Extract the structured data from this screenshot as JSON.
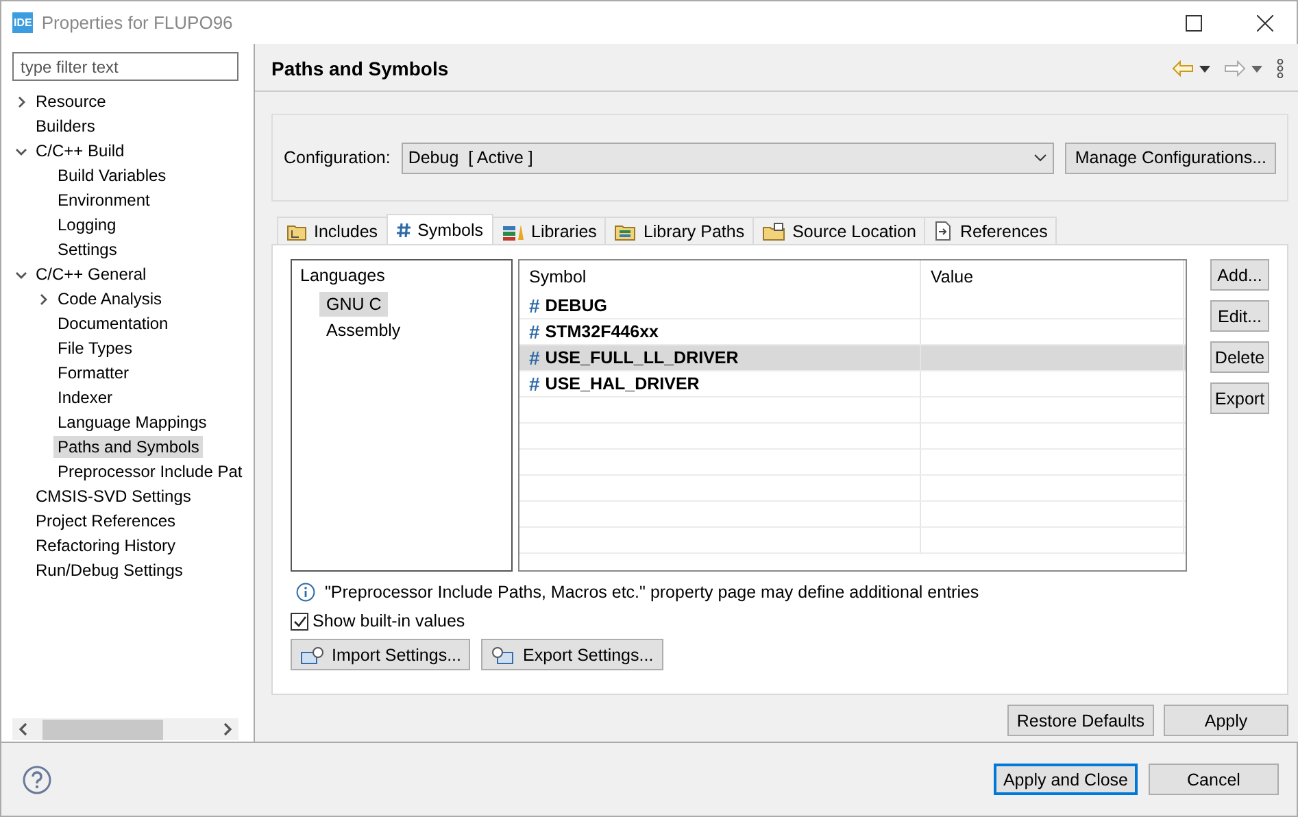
{
  "window": {
    "app_badge": "IDE",
    "title": "Properties for FLUPO96"
  },
  "sidebar": {
    "filter": {
      "placeholder": "type filter text"
    },
    "items": [
      {
        "label": "Resource",
        "expanded": false,
        "selected": false
      },
      {
        "label": "Builders",
        "selected": false
      },
      {
        "label": "C/C++ Build",
        "expanded": true,
        "selected": false,
        "children": [
          {
            "label": "Build Variables",
            "selected": false
          },
          {
            "label": "Environment",
            "selected": false
          },
          {
            "label": "Logging",
            "selected": false
          },
          {
            "label": "Settings",
            "selected": false
          }
        ]
      },
      {
        "label": "C/C++ General",
        "expanded": true,
        "selected": false,
        "children": [
          {
            "label": "Code Analysis",
            "expanded": false,
            "selected": false
          },
          {
            "label": "Documentation",
            "selected": false
          },
          {
            "label": "File Types",
            "selected": false
          },
          {
            "label": "Formatter",
            "selected": false
          },
          {
            "label": "Indexer",
            "selected": false
          },
          {
            "label": "Language Mappings",
            "selected": false
          },
          {
            "label": "Paths and Symbols",
            "selected": true
          },
          {
            "label": "Preprocessor Include Pat",
            "selected": false
          }
        ]
      },
      {
        "label": "CMSIS-SVD Settings",
        "selected": false
      },
      {
        "label": "Project References",
        "selected": false
      },
      {
        "label": "Refactoring History",
        "selected": false
      },
      {
        "label": "Run/Debug Settings",
        "selected": false
      }
    ]
  },
  "page": {
    "title": "Paths and Symbols",
    "configuration": {
      "label": "Configuration:",
      "value": "Debug  [ Active ]",
      "manage_button": "Manage Configurations..."
    },
    "tabs": [
      {
        "label": "Includes",
        "kind": "includes",
        "selected": false
      },
      {
        "label": "Symbols",
        "kind": "symbols",
        "selected": true
      },
      {
        "label": "Libraries",
        "kind": "libraries",
        "selected": false
      },
      {
        "label": "Library Paths",
        "kind": "librarypaths",
        "selected": false
      },
      {
        "label": "Source Location",
        "kind": "source",
        "selected": false
      },
      {
        "label": "References",
        "kind": "references",
        "selected": false
      }
    ],
    "languages": {
      "heading": "Languages",
      "items": [
        {
          "label": "GNU C",
          "selected": true
        },
        {
          "label": "Assembly",
          "selected": false
        }
      ]
    },
    "symbols": {
      "columns": [
        "Symbol",
        "Value"
      ],
      "rows": [
        {
          "symbol": "#",
          "name": "DEBUG",
          "selected": false
        },
        {
          "symbol": "#",
          "name": "STM32F446xx",
          "selected": false
        },
        {
          "symbol": "#",
          "name": "USE_FULL_LL_DRIVER",
          "selected": true
        },
        {
          "symbol": "#",
          "name": "USE_HAL_DRIVER",
          "selected": false
        }
      ]
    },
    "side_buttons": [
      "Add...",
      "Edit...",
      "Delete",
      "Export"
    ],
    "info": "\"Preprocessor Include Paths, Macros etc.\" property page may define additional entries",
    "show_builtin": {
      "label": "Show built-in values",
      "checked": true
    },
    "import_button": "Import Settings...",
    "export_button": "Export Settings...",
    "restore_button": "Restore Defaults",
    "apply_button": "Apply"
  },
  "footer": {
    "apply_close": "Apply and Close",
    "cancel": "Cancel"
  }
}
